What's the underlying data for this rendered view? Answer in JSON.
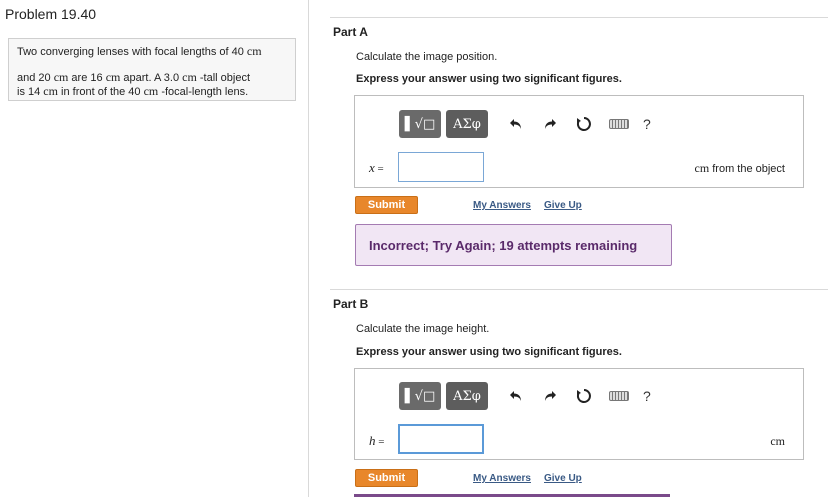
{
  "problem": {
    "title": "Problem 19.40",
    "text_parts": [
      "Two converging lenses with focal lengths of 40 ",
      "cm",
      "\nand 20 ",
      "cm",
      " are 16 ",
      "cm",
      " apart. A 3.0 ",
      "cm",
      " -tall object\nis 14 ",
      "cm",
      " in front of the 40 ",
      "cm",
      " -focal-length lens."
    ]
  },
  "toolbar": {
    "templates_label": "▌√□",
    "symbols_label": "ΑΣφ",
    "undo_icon": "undo-icon",
    "redo_icon": "redo-icon",
    "reset_icon": "reset-icon",
    "keyboard_icon": "keyboard-icon",
    "help_label": "?"
  },
  "partA": {
    "title": "Part A",
    "prompt": "Calculate the image position.",
    "instruction": "Express your answer using two significant figures.",
    "variable": "x",
    "equals": " =",
    "input_value": "",
    "units_serif": "cm",
    "units_rest": " from the object",
    "submit_label": "Submit",
    "my_answers_label": "My Answers",
    "give_up_label": "Give Up",
    "feedback": "Incorrect; Try Again; 19 attempts remaining"
  },
  "partB": {
    "title": "Part B",
    "prompt": "Calculate the image height.",
    "instruction": "Express your answer using two significant figures.",
    "variable": "h",
    "equals": " =",
    "input_value": "",
    "units_serif": "cm",
    "submit_label": "Submit",
    "my_answers_label": "My Answers",
    "give_up_label": "Give Up"
  }
}
